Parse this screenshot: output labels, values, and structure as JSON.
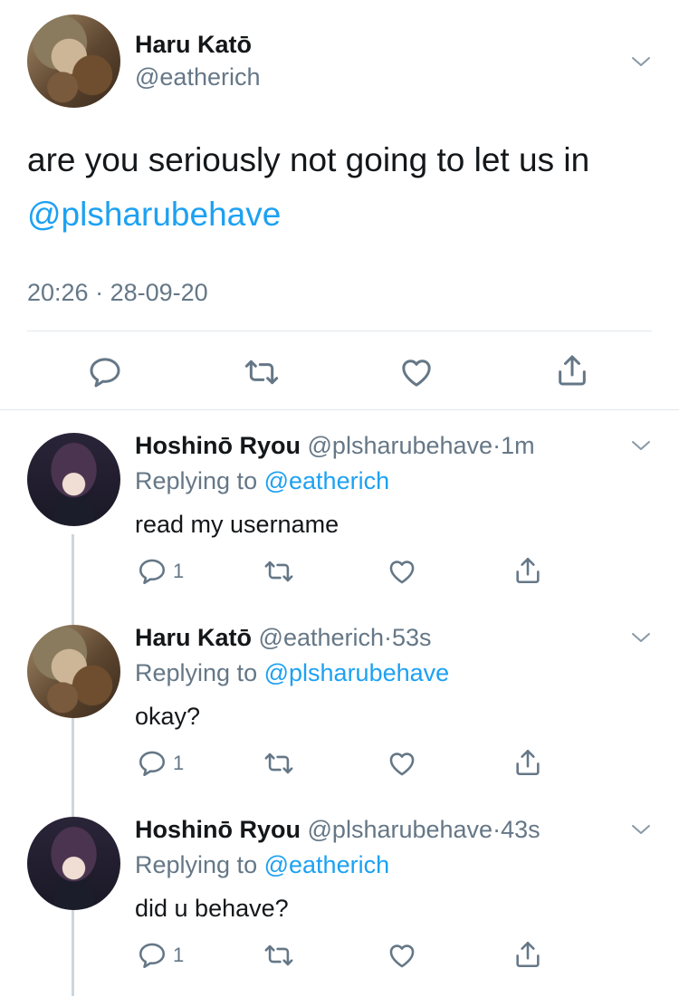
{
  "main_tweet": {
    "author_name": "Haru Katō",
    "author_handle": "@eatherich",
    "text": "are you seriously not going to let us in",
    "mention": "@plsharubehave",
    "time": "20:26",
    "date": "28-09-20"
  },
  "replies": [
    {
      "author_name": "Hoshinō Ryou",
      "author_handle": "@plsharubehave",
      "time_ago": "1m",
      "replying_label": "Replying to",
      "replying_to": "@eatherich",
      "text": "read my username",
      "reply_count": "1"
    },
    {
      "author_name": "Haru Katō",
      "author_handle": "@eatherich",
      "time_ago": "53s",
      "replying_label": "Replying to",
      "replying_to": "@plsharubehave",
      "text": "okay?",
      "reply_count": "1"
    },
    {
      "author_name": "Hoshinō Ryou",
      "author_handle": "@plsharubehave",
      "time_ago": "43s",
      "replying_label": "Replying to",
      "replying_to": "@eatherich",
      "text": "did u behave?",
      "reply_count": "1"
    }
  ],
  "separator": "·",
  "colors": {
    "link": "#1da1f2",
    "muted": "#657786",
    "divider": "#e1e8ed"
  },
  "icons": [
    "chevron-down-icon",
    "reply-icon",
    "retweet-icon",
    "like-icon",
    "share-icon"
  ]
}
